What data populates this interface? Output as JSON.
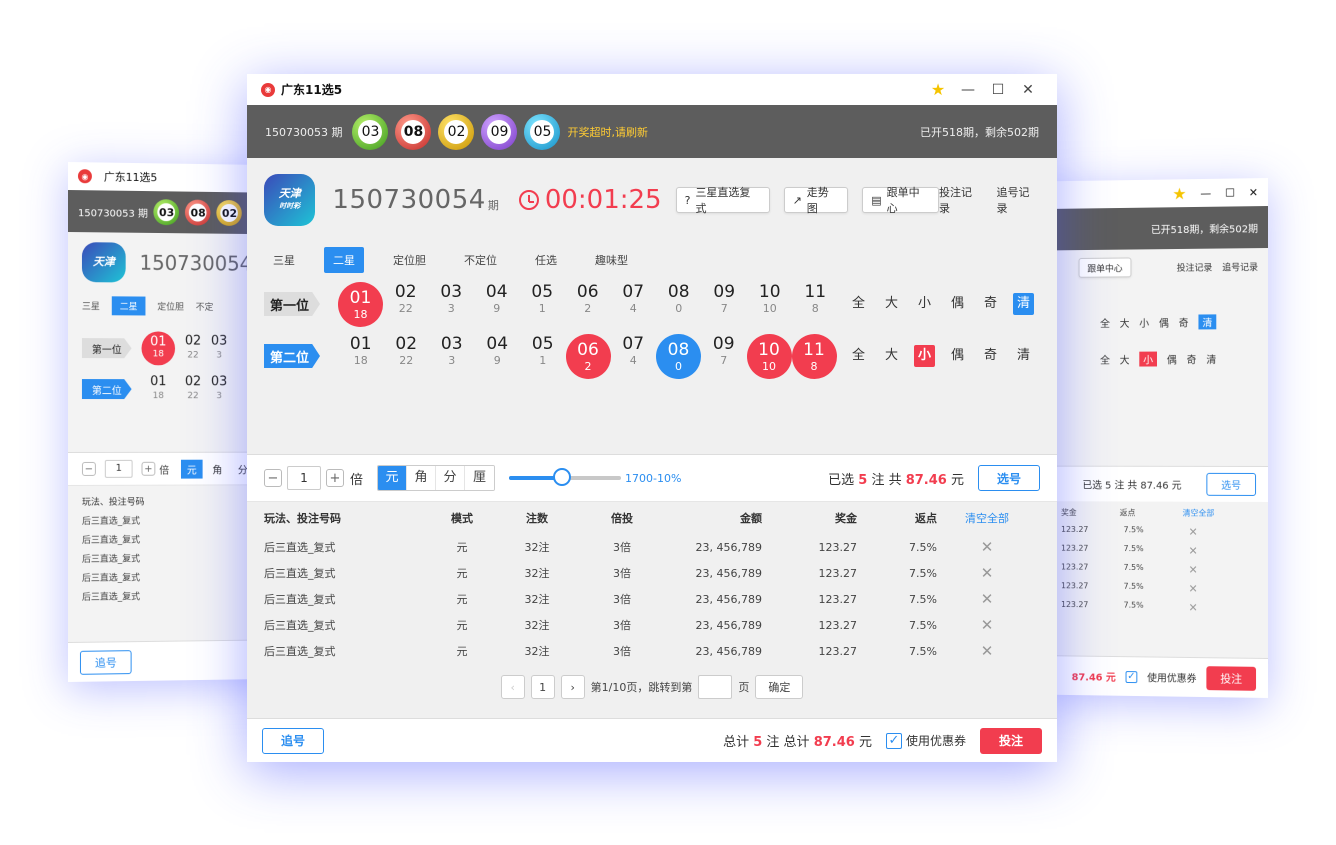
{
  "app": {
    "title": "广东11选5"
  },
  "side_left": {
    "title": "广东11选5",
    "prev_issue": "150730053 期",
    "balls": [
      "03",
      "08",
      "02"
    ],
    "issue": "150730054",
    "tabs": [
      "三星",
      "二星",
      "定位胆",
      "不定"
    ],
    "pos1": "第一位",
    "pos2": "第二位",
    "row1": [
      {
        "n": "01",
        "m": "18"
      },
      {
        "n": "02",
        "m": "22"
      },
      {
        "n": "03",
        "m": "3"
      }
    ],
    "row2": [
      {
        "n": "01",
        "m": "18"
      },
      {
        "n": "02",
        "m": "22"
      },
      {
        "n": "03",
        "m": "3"
      }
    ],
    "qty": "1",
    "mult": "倍",
    "units": [
      "元",
      "角",
      "分"
    ],
    "list_header": "玩法、投注号码",
    "list": [
      "后三直选_复式",
      "后三直选_复式",
      "后三直选_复式",
      "后三直选_复式",
      "后三直选_复式"
    ],
    "chase": "追号"
  },
  "side_right": {
    "remain": "已开518期，剩余502期",
    "follow": "跟单中心",
    "rec1": "投注记录",
    "rec2": "追号记录",
    "filters": [
      "全",
      "大",
      "小",
      "偶",
      "奇",
      "清"
    ],
    "col_bonus": "奖金",
    "col_rebate": "返点",
    "clear": "清空全部",
    "rows": [
      {
        "b": "123.27",
        "r": "7.5%"
      },
      {
        "b": "123.27",
        "r": "7.5%"
      },
      {
        "b": "123.27",
        "r": "7.5%"
      },
      {
        "b": "123.27",
        "r": "7.5%"
      },
      {
        "b": "123.27",
        "r": "7.5%"
      }
    ],
    "selected": "已选 5 注  共 87.46 元",
    "select_btn": "选号",
    "total": "87.46 元",
    "coupon": "使用优惠券",
    "bet": "投注"
  },
  "header": {
    "prev_issue": "150730053 期",
    "balls": [
      {
        "v": "03",
        "c": "green"
      },
      {
        "v": "08",
        "c": "red"
      },
      {
        "v": "02",
        "c": "yellow"
      },
      {
        "v": "09",
        "c": "purple"
      },
      {
        "v": "05",
        "c": "cyan"
      }
    ],
    "warning": "开奖超时,请刷新",
    "remain": "已开518期，剩余502期"
  },
  "issue": {
    "logo_top": "天津",
    "logo_bottom": "时时彩",
    "number": "150730054",
    "unit": "期",
    "countdown": "00:01:25",
    "btn_help": "三星直选复式",
    "btn_trend": "走势图",
    "btn_follow": "跟单中心",
    "link_bet_record": "投注记录",
    "link_chase_record": "追号记录"
  },
  "tabs": [
    "三星",
    "二星",
    "定位胆",
    "不定位",
    "任选",
    "趣味型"
  ],
  "positions": [
    {
      "label": "第一位",
      "numbers": [
        {
          "n": "01",
          "m": "18",
          "s": "red"
        },
        {
          "n": "02",
          "m": "22"
        },
        {
          "n": "03",
          "m": "3"
        },
        {
          "n": "04",
          "m": "9"
        },
        {
          "n": "05",
          "m": "1"
        },
        {
          "n": "06",
          "m": "2"
        },
        {
          "n": "07",
          "m": "4"
        },
        {
          "n": "08",
          "m": "0"
        },
        {
          "n": "09",
          "m": "7"
        },
        {
          "n": "10",
          "m": "10"
        },
        {
          "n": "11",
          "m": "8"
        }
      ],
      "filters": [
        "全",
        "大",
        "小",
        "偶",
        "奇",
        "清"
      ],
      "active_filter": 5
    },
    {
      "label": "第二位",
      "numbers": [
        {
          "n": "01",
          "m": "18"
        },
        {
          "n": "02",
          "m": "22"
        },
        {
          "n": "03",
          "m": "3"
        },
        {
          "n": "04",
          "m": "9"
        },
        {
          "n": "05",
          "m": "1"
        },
        {
          "n": "06",
          "m": "2",
          "s": "red"
        },
        {
          "n": "07",
          "m": "4"
        },
        {
          "n": "08",
          "m": "0",
          "s": "blue"
        },
        {
          "n": "09",
          "m": "7"
        },
        {
          "n": "10",
          "m": "10",
          "s": "red"
        },
        {
          "n": "11",
          "m": "8",
          "s": "red"
        }
      ],
      "filters": [
        "全",
        "大",
        "小",
        "偶",
        "奇",
        "清"
      ],
      "active_filter": 2
    }
  ],
  "betbar": {
    "minus": "−",
    "qty": "1",
    "plus": "+",
    "mult_label": "倍",
    "units": [
      "元",
      "角",
      "分",
      "厘"
    ],
    "rate": "1700-10%",
    "selected_prefix": "已选",
    "selected_count": "5",
    "selected_mid": "注  共",
    "selected_amount": "87.46",
    "selected_suffix": "元",
    "select_btn": "选号"
  },
  "table": {
    "headers": [
      "玩法、投注号码",
      "模式",
      "注数",
      "倍投",
      "金额",
      "奖金",
      "返点",
      "清空全部"
    ],
    "rows": [
      [
        "后三直选_复式",
        "元",
        "32注",
        "3倍",
        "23, 456,789",
        "123.27",
        "7.5%"
      ],
      [
        "后三直选_复式",
        "元",
        "32注",
        "3倍",
        "23, 456,789",
        "123.27",
        "7.5%"
      ],
      [
        "后三直选_复式",
        "元",
        "32注",
        "3倍",
        "23, 456,789",
        "123.27",
        "7.5%"
      ],
      [
        "后三直选_复式",
        "元",
        "32注",
        "3倍",
        "23, 456,789",
        "123.27",
        "7.5%"
      ],
      [
        "后三直选_复式",
        "元",
        "32注",
        "3倍",
        "23, 456,789",
        "123.27",
        "7.5%"
      ]
    ]
  },
  "pager": {
    "prev": "‹",
    "page": "1",
    "next": "›",
    "info": "第1/10页，跳转到第",
    "suffix": "页",
    "ok": "确定"
  },
  "footer": {
    "chase": "追号",
    "total_prefix": "总计",
    "total_count": "5",
    "total_mid": "注  总计",
    "total_amount": "87.46",
    "total_suffix": "元",
    "coupon": "使用优惠券",
    "bet": "投注"
  },
  "colors": {
    "accent": "#2b8ef0",
    "red": "#f23d4f"
  }
}
